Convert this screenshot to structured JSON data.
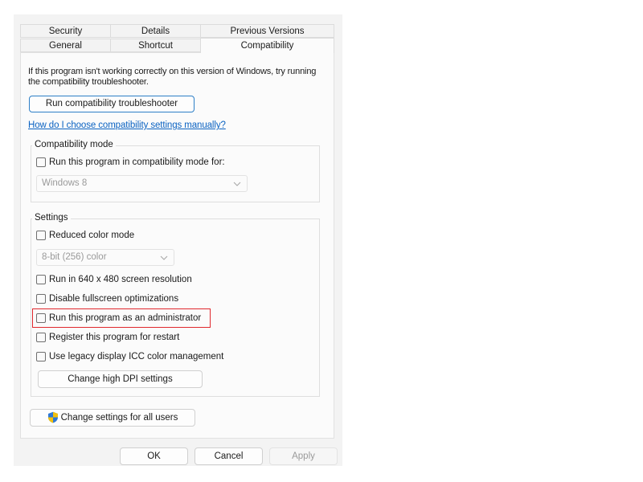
{
  "tabs": {
    "row1": [
      "Security",
      "Details",
      "Previous Versions"
    ],
    "row2": [
      "General",
      "Shortcut",
      "Compatibility"
    ],
    "active": "Compatibility"
  },
  "intro_text": "If this program isn't working correctly on this version of Windows, try running the compatibility troubleshooter.",
  "run_troubleshooter_label": "Run compatibility troubleshooter",
  "manual_link": "How do I choose compatibility settings manually?",
  "compat_mode": {
    "title": "Compatibility mode",
    "checkbox_label": "Run this program in compatibility mode for:",
    "checked": false,
    "selected_os": "Windows 8"
  },
  "settings": {
    "title": "Settings",
    "reduced_color": {
      "label": "Reduced color mode",
      "checked": false
    },
    "color_depth": "8-bit (256) color",
    "res_640": {
      "label": "Run in 640 x 480 screen resolution",
      "checked": false
    },
    "disable_fullscreen": {
      "label": "Disable fullscreen optimizations",
      "checked": false
    },
    "run_as_admin": {
      "label": "Run this program as an administrator",
      "checked": false
    },
    "register_restart": {
      "label": "Register this program for restart",
      "checked": false
    },
    "legacy_icc": {
      "label": "Use legacy display ICC color management",
      "checked": false
    },
    "dpi_button": "Change high DPI settings"
  },
  "all_users_button": "Change settings for all users",
  "footer": {
    "ok": "OK",
    "cancel": "Cancel",
    "apply": "Apply"
  },
  "colors": {
    "highlight": "#e0282d",
    "link": "#0a62c2",
    "accent_border": "#2d7fc7"
  },
  "icons": {
    "shield": "uac-shield-icon",
    "chevron": "chevron-down-icon"
  }
}
